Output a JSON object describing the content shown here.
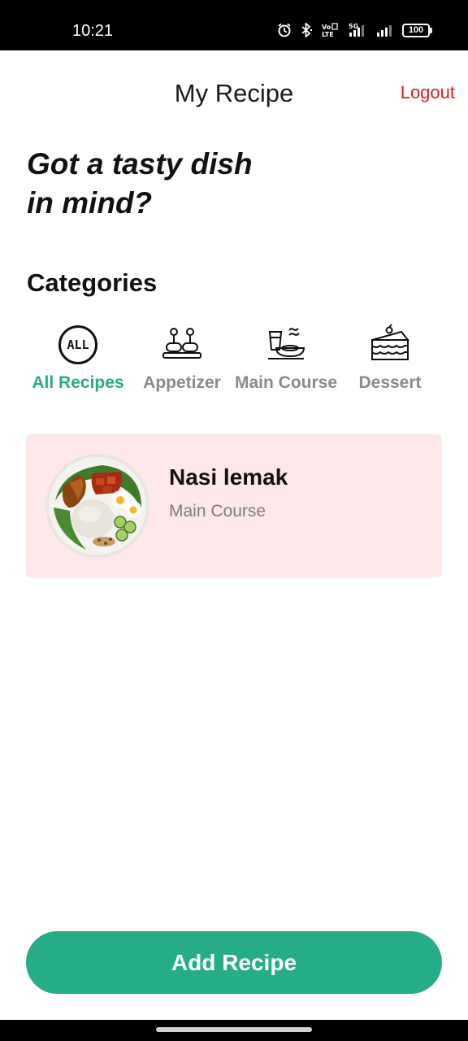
{
  "status_bar": {
    "time": "10:21",
    "network_label": "VoLTE",
    "network_gen": "5G",
    "battery": "100"
  },
  "header": {
    "title": "My Recipe",
    "logout_label": "Logout",
    "logout_color": "#d32020"
  },
  "headline": {
    "line1": "Got a tasty dish",
    "line2": "in mind?"
  },
  "categories": {
    "title": "Categories",
    "active_color": "#2aab86",
    "items": [
      {
        "label": "All Recipes",
        "icon": "all-badge-icon",
        "icon_text": "ALL",
        "active": true
      },
      {
        "label": "Appetizer",
        "icon": "appetizer-skewer-icon",
        "active": false
      },
      {
        "label": "Main Course",
        "icon": "main-course-meal-icon",
        "active": false
      },
      {
        "label": "Dessert",
        "icon": "cake-slice-icon",
        "active": false
      }
    ]
  },
  "recipes": [
    {
      "name": "Nasi lemak",
      "category": "Main Course",
      "card_color": "#ffe8ea"
    }
  ],
  "actions": {
    "add_label": "Add Recipe",
    "accent_color": "#26ad87"
  }
}
